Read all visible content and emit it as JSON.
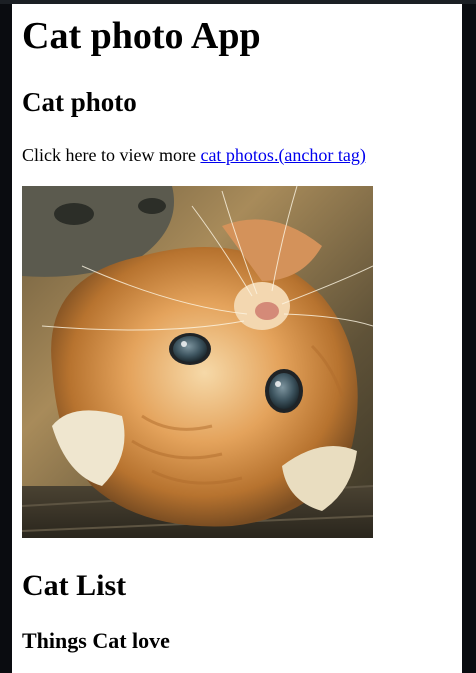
{
  "header": {
    "title": "Cat photo App"
  },
  "photo_section": {
    "heading": "Cat photo",
    "intro_text": "Click here to view more ",
    "link_text": "cat photos.(anchor tag)",
    "image_subject": "orange kitten lying upside down"
  },
  "list_section": {
    "heading": "Cat List",
    "subheading": "Things Cat love"
  },
  "colors": {
    "page_background": "#ffffff",
    "frame_background": "#0a0c10",
    "link": "#0000ee",
    "text": "#000000"
  }
}
